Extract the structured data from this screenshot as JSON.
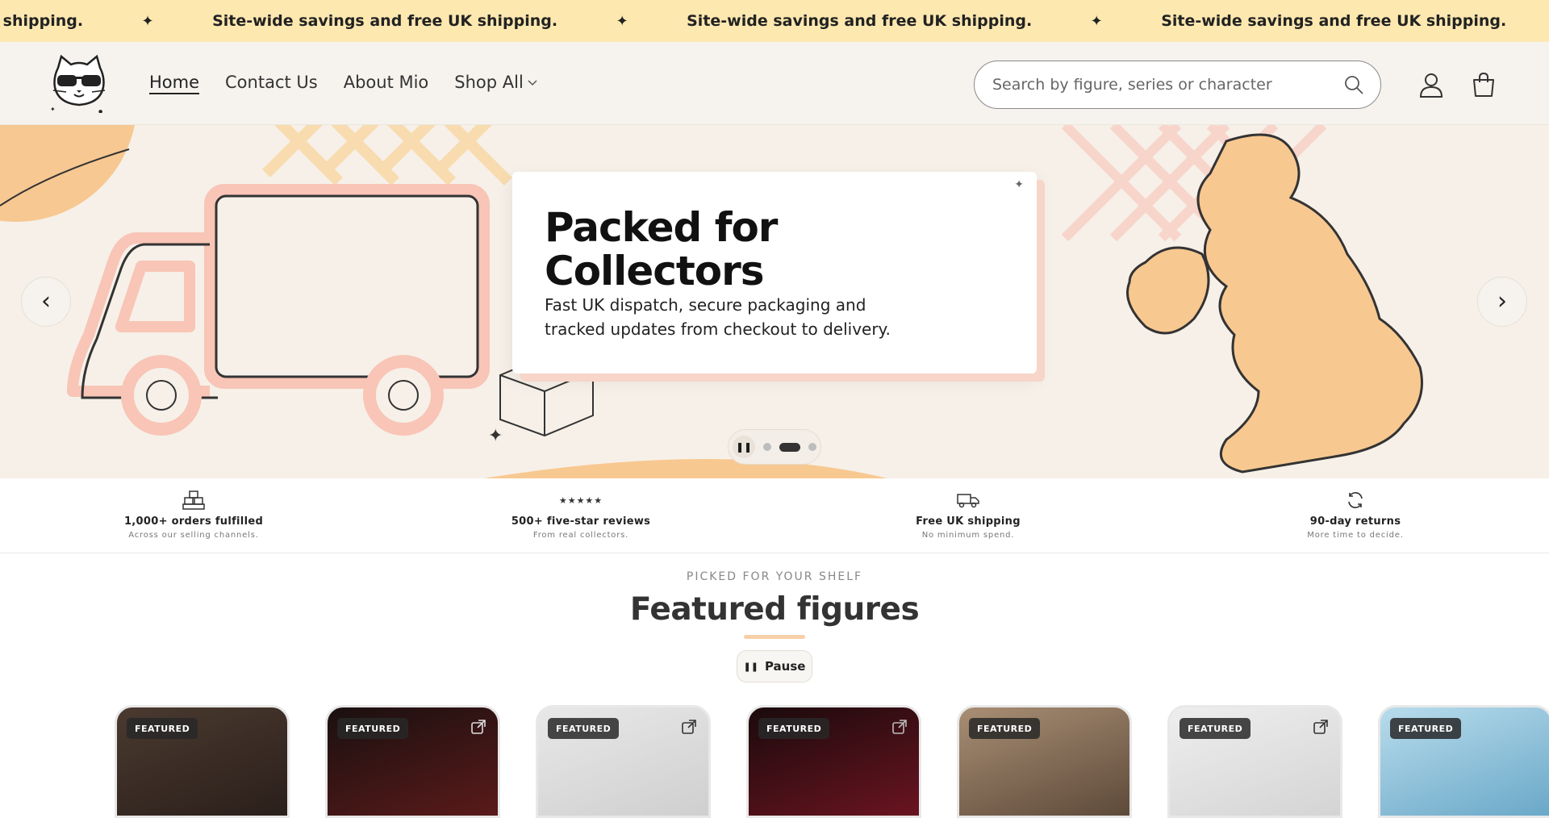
{
  "announcement": {
    "text": "Site-wide savings and free UK shipping.",
    "separator": "✦"
  },
  "header": {
    "logo": "cat-with-sunglasses-logo",
    "nav": [
      {
        "label": "Home",
        "active": true
      },
      {
        "label": "Contact Us"
      },
      {
        "label": "About Mio"
      },
      {
        "label": "Shop All"
      }
    ],
    "search": {
      "placeholder": "Search by figure, series or character"
    },
    "icons": [
      "search-icon",
      "account-icon",
      "cart-icon"
    ]
  },
  "hero": {
    "title": "Packed for Collectors",
    "text": "Fast UK dispatch, secure packaging and tracked updates from checkout to delivery.",
    "controls": {
      "prev": "‹",
      "next": "›",
      "slides": 3,
      "active_slide": 2
    }
  },
  "trust": [
    {
      "icon": "boxes-icon",
      "title": "1,000+ orders fulfilled",
      "sub": "Across our selling channels."
    },
    {
      "icon": "stars-icon",
      "title": "500+ five-star reviews",
      "sub": "From real collectors."
    },
    {
      "icon": "truck-icon",
      "title": "Free UK shipping",
      "sub": "No minimum spend."
    },
    {
      "icon": "refresh-icon",
      "title": "90-day returns",
      "sub": "More time to decide."
    }
  ],
  "featured": {
    "kicker": "PICKED FOR YOUR SHELF",
    "title": "Featured figures",
    "pause_label": "Pause",
    "badge": "FEATURED",
    "cards": [
      {
        "bg": "#3a2a24"
      },
      {
        "bg": "#2a1414"
      },
      {
        "bg": "#dcdcdc"
      },
      {
        "bg": "#2a0f12"
      },
      {
        "bg": "#8f7760"
      },
      {
        "bg": "#e2e2e2"
      },
      {
        "bg": "#9ec9de"
      }
    ]
  },
  "colors": {
    "announcement_bg": "#fde8b0",
    "header_bg": "#f6f3ee",
    "hero_bg": "#f6f0e8",
    "accent_peach": "#f7cfa8",
    "accent_pink": "#f8c7b8"
  }
}
